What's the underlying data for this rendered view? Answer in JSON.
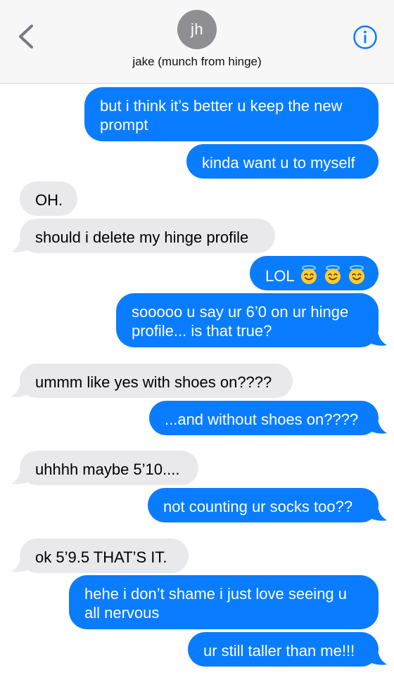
{
  "header": {
    "avatar_initials": "jh",
    "contact_name": "jake (munch from hinge)",
    "back_icon": "chevron-left-icon",
    "info_icon": "info-icon",
    "accent_color": "#0a7cff"
  },
  "messages": [
    {
      "from": "me",
      "text": "but i think it’s better u keep the new prompt"
    },
    {
      "from": "me",
      "text": "kinda want u to myself"
    },
    {
      "from": "them",
      "text": "OH."
    },
    {
      "from": "them",
      "text": "should i delete my hinge profile"
    },
    {
      "from": "me",
      "text": "LOL"
    },
    {
      "from": "me",
      "text": "sooooo u say ur 6’0 on ur hinge profile... is that true?"
    },
    {
      "from": "them",
      "text": "ummm like yes with shoes on????"
    },
    {
      "from": "me",
      "text": "...and without shoes on????"
    },
    {
      "from": "them",
      "text": "uhhhh maybe 5’10...."
    },
    {
      "from": "me",
      "text": "not counting ur socks too??"
    },
    {
      "from": "them",
      "text": "ok 5’9.5 THAT’S IT."
    },
    {
      "from": "me",
      "text": "hehe i don’t shame i just love seeing u all nervous"
    },
    {
      "from": "me",
      "text": "ur still taller than me!!!"
    }
  ],
  "emoji": "smiling-face-with-halo-icon"
}
